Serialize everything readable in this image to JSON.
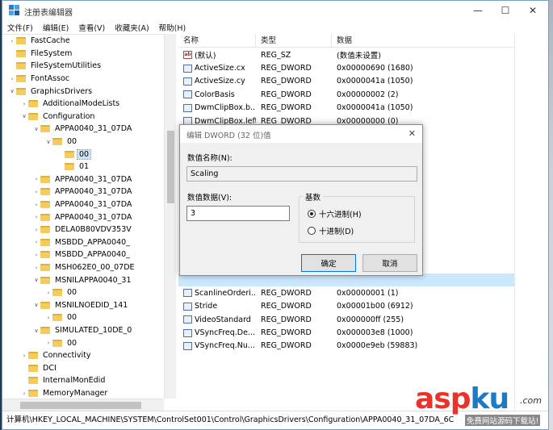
{
  "window": {
    "title": "注册表编辑器",
    "controls": {
      "minimize": "—",
      "maximize": "☐",
      "close": "✕"
    }
  },
  "menu": [
    "文件(F)",
    "编辑(E)",
    "查看(V)",
    "收藏夹(A)",
    "帮助(H)"
  ],
  "tree": [
    {
      "label": "FastCache",
      "depth": 3,
      "arrow": ">"
    },
    {
      "label": "FileSystem",
      "depth": 3,
      "arrow": ""
    },
    {
      "label": "FileSystemUtilities",
      "depth": 3,
      "arrow": ""
    },
    {
      "label": "FontAssoc",
      "depth": 3,
      "arrow": ">"
    },
    {
      "label": "GraphicsDrivers",
      "depth": 3,
      "arrow": "v"
    },
    {
      "label": "AdditionalModeLists",
      "depth": 4,
      "arrow": ">"
    },
    {
      "label": "Configuration",
      "depth": 4,
      "arrow": "v"
    },
    {
      "label": "APPA0040_31_07DA",
      "depth": 5,
      "arrow": "v"
    },
    {
      "label": "00",
      "depth": 6,
      "arrow": "v"
    },
    {
      "label": "00",
      "depth": 7,
      "arrow": "",
      "selected": true
    },
    {
      "label": "01",
      "depth": 7,
      "arrow": ""
    },
    {
      "label": "APPA0040_31_07DA",
      "depth": 5,
      "arrow": ">"
    },
    {
      "label": "APPA0040_31_07DA",
      "depth": 5,
      "arrow": ">"
    },
    {
      "label": "APPA0040_31_07DA",
      "depth": 5,
      "arrow": ">"
    },
    {
      "label": "APPA0040_31_07DA",
      "depth": 5,
      "arrow": ">"
    },
    {
      "label": "DELA0B80VDV353V",
      "depth": 5,
      "arrow": ">"
    },
    {
      "label": "MSBDD_APPA0040_",
      "depth": 5,
      "arrow": ">"
    },
    {
      "label": "MSBDD_APPA0040_",
      "depth": 5,
      "arrow": ">"
    },
    {
      "label": "MSH062E0_00_07DE",
      "depth": 5,
      "arrow": ">"
    },
    {
      "label": "MSNILAPPA0040_31",
      "depth": 5,
      "arrow": "v"
    },
    {
      "label": "00",
      "depth": 6,
      "arrow": ">"
    },
    {
      "label": "MSNILNOEDID_141",
      "depth": 5,
      "arrow": "v"
    },
    {
      "label": "00",
      "depth": 6,
      "arrow": ">"
    },
    {
      "label": "SIMULATED_10DE_0",
      "depth": 5,
      "arrow": "v"
    },
    {
      "label": "00",
      "depth": 6,
      "arrow": ">"
    },
    {
      "label": "Connectivity",
      "depth": 4,
      "arrow": ">"
    },
    {
      "label": "DCI",
      "depth": 4,
      "arrow": ""
    },
    {
      "label": "InternalMonEdid",
      "depth": 4,
      "arrow": ""
    },
    {
      "label": "MemoryManager",
      "depth": 4,
      "arrow": ">"
    }
  ],
  "list": {
    "headers": [
      "名称",
      "类型",
      "数据"
    ],
    "rows": [
      {
        "name": "(默认)",
        "type": "REG_SZ",
        "data": "(数值未设置)",
        "icon": "string-value-icon"
      },
      {
        "name": "ActiveSize.cx",
        "type": "REG_DWORD",
        "data": "0x00000690 (1680)",
        "icon": "dword-value-icon"
      },
      {
        "name": "ActiveSize.cy",
        "type": "REG_DWORD",
        "data": "0x0000041a (1050)",
        "icon": "dword-value-icon"
      },
      {
        "name": "ColorBasis",
        "type": "REG_DWORD",
        "data": "0x00000002 (2)",
        "icon": "dword-value-icon"
      },
      {
        "name": "DwmClipBox.b...",
        "type": "REG_DWORD",
        "data": "0x0000041a (1050)",
        "icon": "dword-value-icon"
      },
      {
        "name": "DwmClipBox.left",
        "type": "REG_DWORD",
        "data": "0x00000000 (0)",
        "icon": "dword-value-icon"
      }
    ],
    "lower_rows": [
      {
        "name": "ScanlineOrderi...",
        "type": "REG_DWORD",
        "data": "0x00000001 (1)",
        "icon": "dword-value-icon"
      },
      {
        "name": "Stride",
        "type": "REG_DWORD",
        "data": "0x00001b00 (6912)",
        "icon": "dword-value-icon"
      },
      {
        "name": "VideoStandard",
        "type": "REG_DWORD",
        "data": "0x000000ff (255)",
        "icon": "dword-value-icon"
      },
      {
        "name": "VSyncFreq.De...",
        "type": "REG_DWORD",
        "data": "0x000003e8 (1000)",
        "icon": "dword-value-icon"
      },
      {
        "name": "VSyncFreq.Nu...",
        "type": "REG_DWORD",
        "data": "0x0000e9eb (59883)",
        "icon": "dword-value-icon"
      }
    ]
  },
  "statusbar": {
    "path": "计算机\\HKEY_LOCAL_MACHINE\\SYSTEM\\ControlSet001\\Control\\GraphicsDrivers\\Configuration\\APPA0040_31_07DA_6C"
  },
  "dialog": {
    "title": "编辑 DWORD (32 位)值",
    "close": "✕",
    "name_label": "数值名称(N):",
    "name_value": "Scaling",
    "data_label": "数值数据(V):",
    "data_value": "3",
    "base_label": "基数",
    "hex_label": "十六进制(H)",
    "dec_label": "十进制(D)",
    "ok": "确定",
    "cancel": "取消"
  },
  "watermark": {
    "logo_a": "asp",
    "logo_k": "ku",
    "dotcom": ".com",
    "slogan": "免费网站源码下载站!"
  }
}
